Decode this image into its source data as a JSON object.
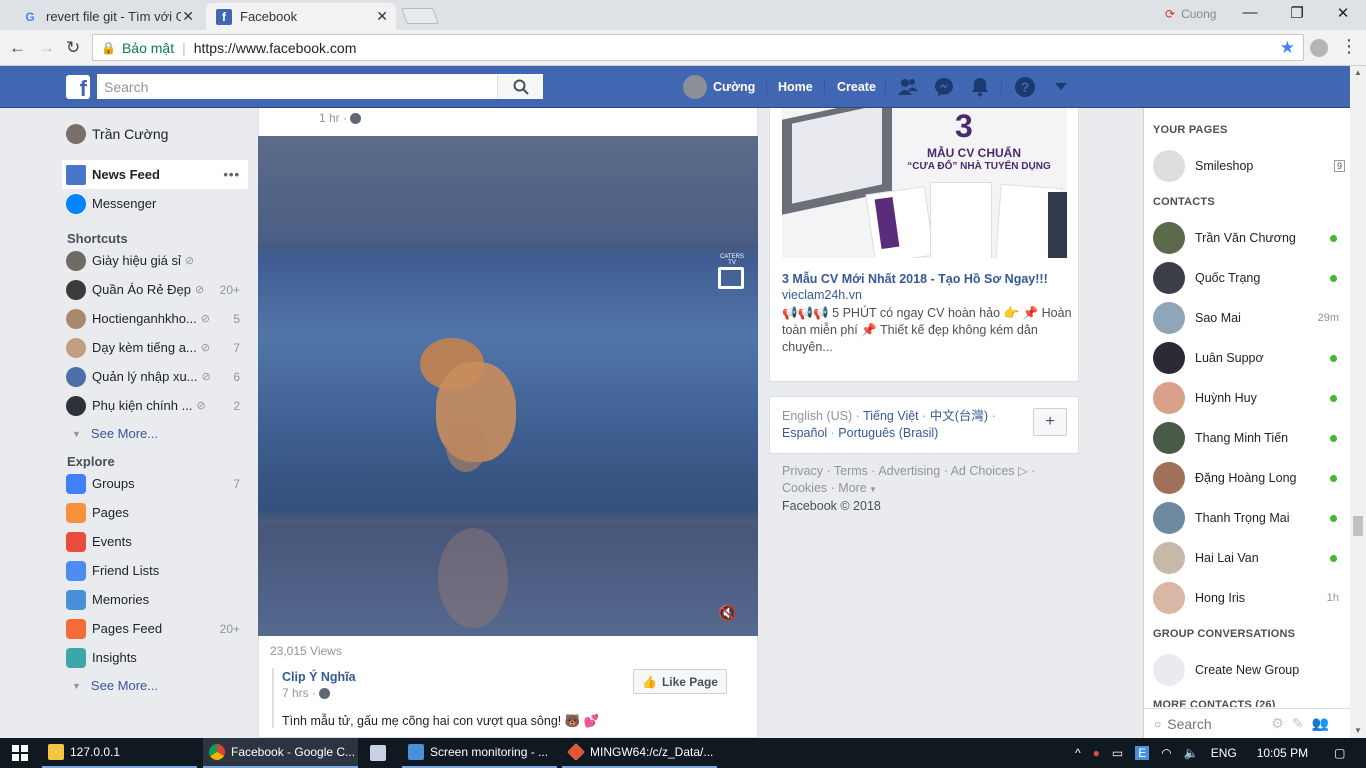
{
  "browser": {
    "tabs": [
      {
        "title": "revert file git - Tìm với Gc",
        "active": false
      },
      {
        "title": "Facebook",
        "active": true
      }
    ],
    "profile_name": "Cuong",
    "secure_label": "Bảo mật",
    "url": "https://www.facebook.com"
  },
  "fb_header": {
    "search_placeholder": "Search",
    "user_name": "Cường",
    "nav": [
      "Home",
      "Create"
    ]
  },
  "left_nav": {
    "profile": "Trần Cường",
    "main": [
      {
        "label": "News Feed"
      },
      {
        "label": "Messenger"
      }
    ],
    "shortcuts_title": "Shortcuts",
    "shortcuts": [
      {
        "label": "Giày hiệu giá sỉ",
        "count": ""
      },
      {
        "label": "Quần Áo Rẻ Đẹp",
        "count": "20+"
      },
      {
        "label": "Hoctienganhkho...",
        "count": "5"
      },
      {
        "label": "Dạy kèm tiếng a...",
        "count": "7"
      },
      {
        "label": "Quản lý nhập xu...",
        "count": "6"
      },
      {
        "label": "Phụ kiện chính ...",
        "count": "2"
      }
    ],
    "see_more": "See More...",
    "explore_title": "Explore",
    "explore": [
      {
        "label": "Groups",
        "count": "7",
        "icon": "groups-icon"
      },
      {
        "label": "Pages",
        "count": "",
        "icon": "pages-flag-icon"
      },
      {
        "label": "Events",
        "count": "",
        "icon": "calendar-icon"
      },
      {
        "label": "Friend Lists",
        "count": "",
        "icon": "friend-lists-icon"
      },
      {
        "label": "Memories",
        "count": "",
        "icon": "clock-icon"
      },
      {
        "label": "Pages Feed",
        "count": "20+",
        "icon": "pages-feed-icon"
      },
      {
        "label": "Insights",
        "count": "",
        "icon": "cube-icon"
      }
    ],
    "see_more_2": "See More..."
  },
  "post": {
    "time_top": "1 hr ·",
    "views": "23,015 Views",
    "page_name": "Clip Ý Nghĩa",
    "time": "7 hrs ·",
    "like_page": "Like Page",
    "caption": "Tình mẫu tử, gấu mẹ cõng hai con vượt qua sông! 🐻 💕",
    "video_badge": "CATERS TV"
  },
  "ad": {
    "image_big": "3",
    "image_line1": "MẪU CV CHUẨN",
    "image_line2": "“CƯA ĐỔ” NHÀ TUYỂN DỤNG",
    "title": "3 Mẫu CV Mới Nhất 2018 - Tạo Hồ Sơ Ngay!!!",
    "domain": "vieclam24h.vn",
    "body": "📢📢📢 5 PHÚT có ngay CV hoàn hảo 👉 📌 Hoàn toàn miễn phí 📌 Thiết kế đẹp không kém dân chuyên..."
  },
  "languages": {
    "current": "English (US)",
    "others": [
      "Tiếng Việt",
      "中文(台灣)",
      "Español",
      "Português (Brasil)"
    ],
    "add": "+"
  },
  "footer": {
    "links": [
      "Privacy",
      "Terms",
      "Advertising",
      "Ad Choices",
      "Cookies",
      "More"
    ],
    "copyright": "Facebook © 2018"
  },
  "chat": {
    "your_pages": "YOUR PAGES",
    "page": {
      "name": "Smileshop",
      "badge": "9"
    },
    "contacts_title": "CONTACTS",
    "contacts": [
      {
        "name": "Trần Văn Chương",
        "status": "online",
        "time": ""
      },
      {
        "name": "Quốc Trạng",
        "status": "online",
        "time": ""
      },
      {
        "name": "Sao Mai",
        "status": "away",
        "time": "29m"
      },
      {
        "name": "Luân Suppơ",
        "status": "online",
        "time": ""
      },
      {
        "name": "Huỳnh Huy",
        "status": "online",
        "time": ""
      },
      {
        "name": "Thang Minh Tiến",
        "status": "online",
        "time": ""
      },
      {
        "name": "Đặng Hoàng Long",
        "status": "online",
        "time": ""
      },
      {
        "name": "Thanh Trọng Mai",
        "status": "online",
        "time": ""
      },
      {
        "name": "Hai Lai Van",
        "status": "online",
        "time": ""
      },
      {
        "name": "Hong Iris",
        "status": "away",
        "time": "1h"
      }
    ],
    "group_title": "GROUP CONVERSATIONS",
    "create_group": "Create New Group",
    "more_contacts": "MORE CONTACTS (26)",
    "search_placeholder": "Search"
  },
  "taskbar": {
    "items": [
      "127.0.0.1",
      "Facebook - Google C...",
      "",
      "Screen monitoring - ...",
      "MINGW64:/c/z_Data/..."
    ],
    "lang": "ENG",
    "clock": "10:05 PM"
  },
  "colors": {
    "fb_blue": "#4267b2",
    "link": "#365899",
    "online": "#42b72a"
  }
}
